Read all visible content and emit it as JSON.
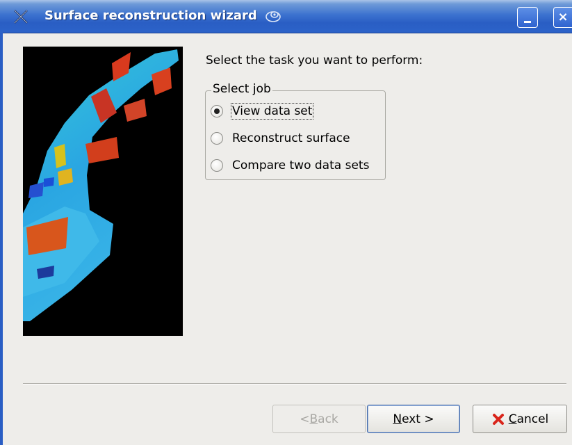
{
  "window": {
    "title": "Surface reconstruction wizard",
    "close_glyph": "×",
    "icons": [
      "app-x-icon",
      "swirl-icon",
      "minimize-icon",
      "close-icon"
    ]
  },
  "wizard": {
    "prompt": "Select the task you want to perform:",
    "group_title": "Select job",
    "options": [
      {
        "label": "View data set",
        "checked": true
      },
      {
        "label": "Reconstruct surface",
        "checked": false
      },
      {
        "label": "Compare two data sets",
        "checked": false
      }
    ]
  },
  "buttons": {
    "back": {
      "prefix": "< ",
      "mnemonic": "B",
      "rest": "ack",
      "enabled": false
    },
    "next": {
      "mnemonic": "N",
      "rest": "ext >",
      "enabled": true
    },
    "cancel": {
      "mnemonic": "C",
      "rest": "ancel",
      "icon": "red-x-icon",
      "enabled": true
    }
  },
  "colors": {
    "titlebar": "#2a5ec4",
    "dialog_bg": "#eeedea",
    "preview_bg": "#000000"
  }
}
